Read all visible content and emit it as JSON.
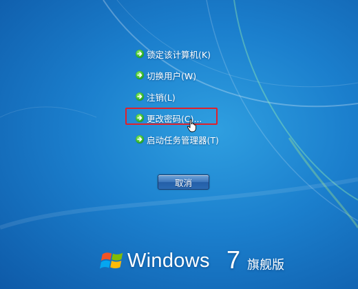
{
  "menu": {
    "items": [
      {
        "label": "锁定该计算机(K)"
      },
      {
        "label": "切换用户(W)"
      },
      {
        "label": "注销(L)"
      },
      {
        "label": "更改密码(C)..."
      },
      {
        "label": "启动任务管理器(T)"
      }
    ]
  },
  "cancel_label": "取消",
  "branding": {
    "name": "Windows",
    "version": "7",
    "edition": "旗舰版"
  },
  "colors": {
    "background": "#1b7fcd",
    "highlight_box": "#e0202a",
    "arrow": "#2fb02a"
  }
}
